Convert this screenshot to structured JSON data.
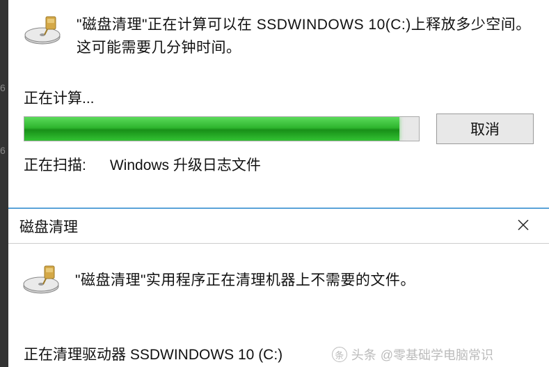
{
  "dialog1": {
    "message": "\"磁盘清理\"正在计算可以在 SSDWINDOWS 10(C:)上释放多少空间。这可能需要几分钟时间。",
    "calculating_label": "正在计算...",
    "progress_percent": 95,
    "cancel_label": "取消",
    "scanning_label": "正在扫描:",
    "scanning_target": "Windows 升级日志文件"
  },
  "dialog2": {
    "title": "磁盘清理",
    "message": "\"磁盘清理\"实用程序正在清理机器上不需要的文件。",
    "bottom_partial": "正在清理驱动器 SSDWINDOWS 10 (C:)"
  },
  "watermark": {
    "prefix": "头条",
    "text": "@零基础学电脑常识"
  },
  "left_marks": [
    "6",
    "6"
  ]
}
